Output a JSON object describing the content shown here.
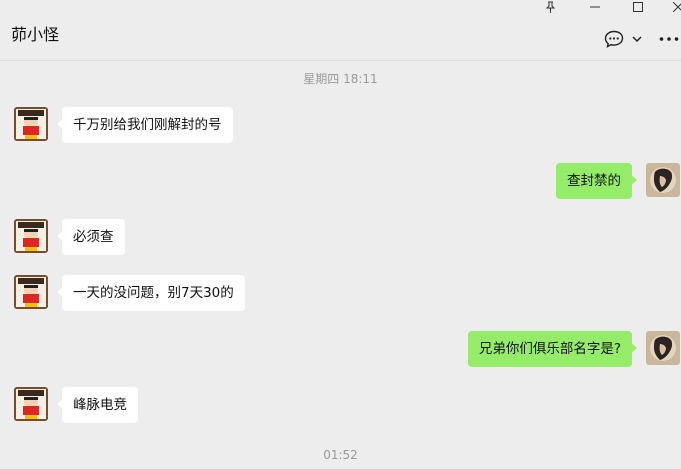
{
  "chat": {
    "title": "茆小怪"
  },
  "timestamps": {
    "top": "星期四 18:11",
    "bottom": "01:52"
  },
  "messages": [
    {
      "side": "left",
      "text": "千万别给我们刚解封的号"
    },
    {
      "side": "right",
      "text": "查封禁的"
    },
    {
      "side": "left",
      "text": "必须查"
    },
    {
      "side": "left",
      "text": "一天的没问题，别7天30的"
    },
    {
      "side": "right",
      "text": "兄弟你们俱乐部名字是?"
    },
    {
      "side": "left",
      "text": "峰脉电竞"
    }
  ],
  "colors": {
    "background": "#ededed",
    "incoming_bubble": "#ffffff",
    "outgoing_bubble": "#95ec69"
  },
  "icons": {
    "pin": "pin-icon",
    "minimize": "minimize-icon",
    "maximize": "maximize-icon",
    "close": "close-icon",
    "chat_bubble": "chat-bubble-icon",
    "dropdown": "chevron-down-icon",
    "more": "more-icon"
  }
}
